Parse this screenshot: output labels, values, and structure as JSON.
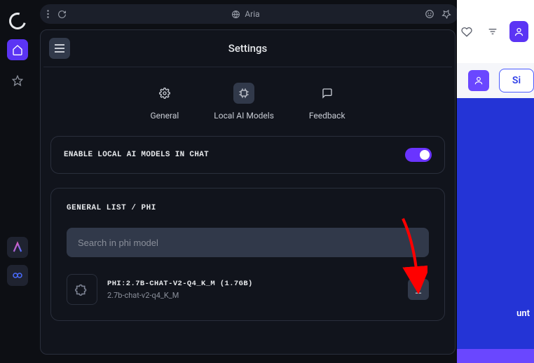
{
  "address_bar": {
    "title": "Aria"
  },
  "right_sliver": {
    "button_label": "Si",
    "text": "unt"
  },
  "panel": {
    "title": "Settings",
    "tabs": [
      {
        "label": "General"
      },
      {
        "label": "Local AI Models"
      },
      {
        "label": "Feedback"
      }
    ],
    "enable_card": {
      "label": "ENABLE LOCAL AI MODELS IN CHAT",
      "toggle": true
    },
    "list_card": {
      "breadcrumb": "GENERAL LIST / PHI",
      "search_placeholder": "Search in phi model",
      "model": {
        "title": "PHI:2.7B-CHAT-V2-Q4_K_M (1.7GB)",
        "subtitle": "2.7b-chat-v2-q4_K_M"
      }
    }
  }
}
